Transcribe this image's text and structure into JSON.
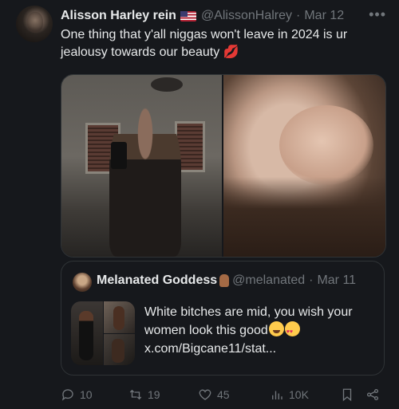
{
  "tweet": {
    "author_name": "Alisson Harley rein",
    "handle": "@AlissonHalrey",
    "separator": "·",
    "date": "Mar 12",
    "more_icon": "more-icon",
    "text_main": "One thing that y'all niggas won't leave in 2024 is ur jealousy towards our beauty",
    "text_emoji": "💋"
  },
  "quote": {
    "author_name": "Melanated Goddess",
    "handle": "@melanated",
    "separator": "·",
    "date": "Mar 11",
    "text_line1": "White bitches are mid, you wish your women look this good",
    "link": "x.com/Bigcane11/stat..."
  },
  "actions": {
    "replies": "10",
    "reposts": "19",
    "likes": "45",
    "views": "10K"
  }
}
